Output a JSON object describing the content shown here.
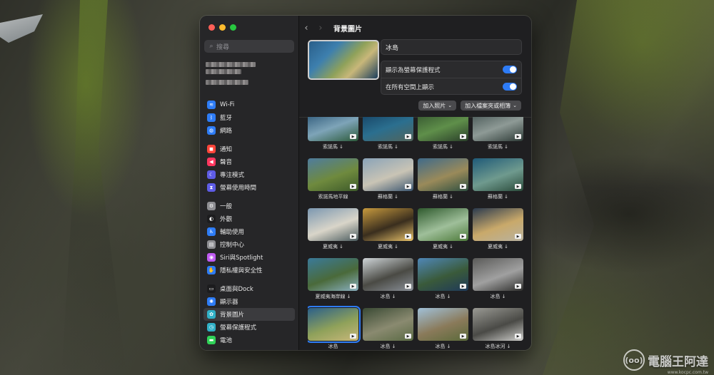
{
  "colors": {
    "accent": "#2e7cf6",
    "selected_row": "#3b3b3e"
  },
  "search": {
    "placeholder": "搜尋"
  },
  "sidebar": {
    "groups": [
      [
        {
          "label": "Wi-Fi",
          "icon": "wifi-icon",
          "color": "#2e7cf6",
          "glyph": "≋"
        },
        {
          "label": "藍牙",
          "icon": "bluetooth-icon",
          "color": "#2e7cf6",
          "glyph": "ᛒ"
        },
        {
          "label": "網路",
          "icon": "globe-icon",
          "color": "#2e7cf6",
          "glyph": "◍"
        }
      ],
      [
        {
          "label": "通知",
          "icon": "bell-icon",
          "color": "#ff453a",
          "glyph": "◼"
        },
        {
          "label": "聲音",
          "icon": "speaker-icon",
          "color": "#ff375f",
          "glyph": "◀"
        },
        {
          "label": "專注模式",
          "icon": "moon-icon",
          "color": "#5e5ce6",
          "glyph": "☾"
        },
        {
          "label": "螢幕使用時間",
          "icon": "hourglass-icon",
          "color": "#5e5ce6",
          "glyph": "⧗"
        }
      ],
      [
        {
          "label": "一般",
          "icon": "gear-icon",
          "color": "#8e8e93",
          "glyph": "⚙"
        },
        {
          "label": "外觀",
          "icon": "appearance-icon",
          "color": "#1c1c1e",
          "glyph": "◐"
        },
        {
          "label": "輔助使用",
          "icon": "accessibility-icon",
          "color": "#2e7cf6",
          "glyph": "♿"
        },
        {
          "label": "控制中心",
          "icon": "control-center-icon",
          "color": "#8e8e93",
          "glyph": "▤"
        },
        {
          "label": "Siri與Spotlight",
          "icon": "siri-icon",
          "color": "#bf5af2",
          "glyph": "◉"
        },
        {
          "label": "隱私權與安全性",
          "icon": "hand-icon",
          "color": "#2e7cf6",
          "glyph": "✋"
        }
      ],
      [
        {
          "label": "桌面與Dock",
          "icon": "dock-icon",
          "color": "#1c1c1e",
          "glyph": "▭"
        },
        {
          "label": "顯示器",
          "icon": "sun-icon",
          "color": "#2e7cf6",
          "glyph": "✺"
        },
        {
          "label": "背景圖片",
          "icon": "wallpaper-icon",
          "color": "#30b0c7",
          "glyph": "✿",
          "selected": true
        },
        {
          "label": "螢幕保護程式",
          "icon": "screensaver-icon",
          "color": "#30b0c7",
          "glyph": "◷"
        },
        {
          "label": "電池",
          "icon": "battery-icon",
          "color": "#30d158",
          "glyph": "▬"
        }
      ]
    ]
  },
  "header": {
    "title": "背景圖片"
  },
  "current": {
    "name": "冰島"
  },
  "options": [
    {
      "label": "顯示為螢幕保護程式",
      "on": true
    },
    {
      "label": "在所有空間上顯示",
      "on": true
    }
  ],
  "buttons": {
    "add_photo": "加入照片",
    "add_folder": "加入檔案夾或相簿"
  },
  "wallpapers": [
    {
      "caption": "索諾馬 ↓",
      "c1": "#1f4b6e",
      "c2": "#7ea4b8",
      "c3": "#2c5a3a"
    },
    {
      "caption": "索諾馬 ↓",
      "c1": "#123a5c",
      "c2": "#2b6f8f",
      "c3": "#52645a"
    },
    {
      "caption": "索諾馬 ↓",
      "c1": "#2c4a2a",
      "c2": "#5f8f4a",
      "c3": "#2a3f2a"
    },
    {
      "caption": "索諾馬 ↓",
      "c1": "#3b4b4a",
      "c2": "#8e9a96",
      "c3": "#2d3a36"
    },
    {
      "caption": "索諾馬地平線",
      "c1": "#4e7c9e",
      "c2": "#6f8a3e",
      "c3": "#3d5a2a"
    },
    {
      "caption": "蘇格蘭 ↓",
      "c1": "#8aa3b8",
      "c2": "#c9c4b5",
      "c3": "#3b5670"
    },
    {
      "caption": "蘇格蘭 ↓",
      "c1": "#3f6a8a",
      "c2": "#9a8a5a",
      "c3": "#2e4f40"
    },
    {
      "caption": "蘇格蘭 ↓",
      "c1": "#1f5a78",
      "c2": "#6f9a8e",
      "c3": "#2a4a3a"
    },
    {
      "caption": "夏威夷 ↓",
      "c1": "#7b97b0",
      "c2": "#d9d5c9",
      "c3": "#4a5b5e"
    },
    {
      "caption": "夏威夷 ↓",
      "c1": "#c79a3e",
      "c2": "#3a2e1e",
      "c3": "#e8c26a"
    },
    {
      "caption": "夏威夷 ↓",
      "c1": "#2f5a2e",
      "c2": "#9fbf9a",
      "c3": "#4d7a3a"
    },
    {
      "caption": "夏威夷 ↓",
      "c1": "#2a3a4e",
      "c2": "#c9a96a",
      "c3": "#b8b2a0"
    },
    {
      "caption": "夏威夷海岸線 ↓",
      "c1": "#3a7a9a",
      "c2": "#4a6a3a",
      "c3": "#8ab0c0"
    },
    {
      "caption": "冰島 ↓",
      "c1": "#cfd5d8",
      "c2": "#4a4a44",
      "c3": "#8a9098"
    },
    {
      "caption": "冰島 ↓",
      "c1": "#4f87b8",
      "c2": "#3a5a3a",
      "c3": "#1f3a5a"
    },
    {
      "caption": "冰島 ↓",
      "c1": "#5a5a58",
      "c2": "#a0a0a0",
      "c3": "#2e2e2c"
    },
    {
      "caption": "冰島",
      "c1": "#2a5f8a",
      "c2": "#8fa15a",
      "c3": "#c8b77a",
      "selected": true
    },
    {
      "caption": "冰島 ↓",
      "c1": "#3a4a34",
      "c2": "#8a8a70",
      "c3": "#5a6a44"
    },
    {
      "caption": "冰島 ↓",
      "c1": "#a0c0d8",
      "c2": "#8a7a5a",
      "c3": "#5a6a3a"
    },
    {
      "caption": "冰島冰河 ↓",
      "c1": "#9a9a94",
      "c2": "#4a4a46",
      "c3": "#cfcfcc"
    }
  ],
  "watermark": {
    "text": "電腦王阿達",
    "url": "www.kocpc.com.tw",
    "logo": "(oo)"
  }
}
